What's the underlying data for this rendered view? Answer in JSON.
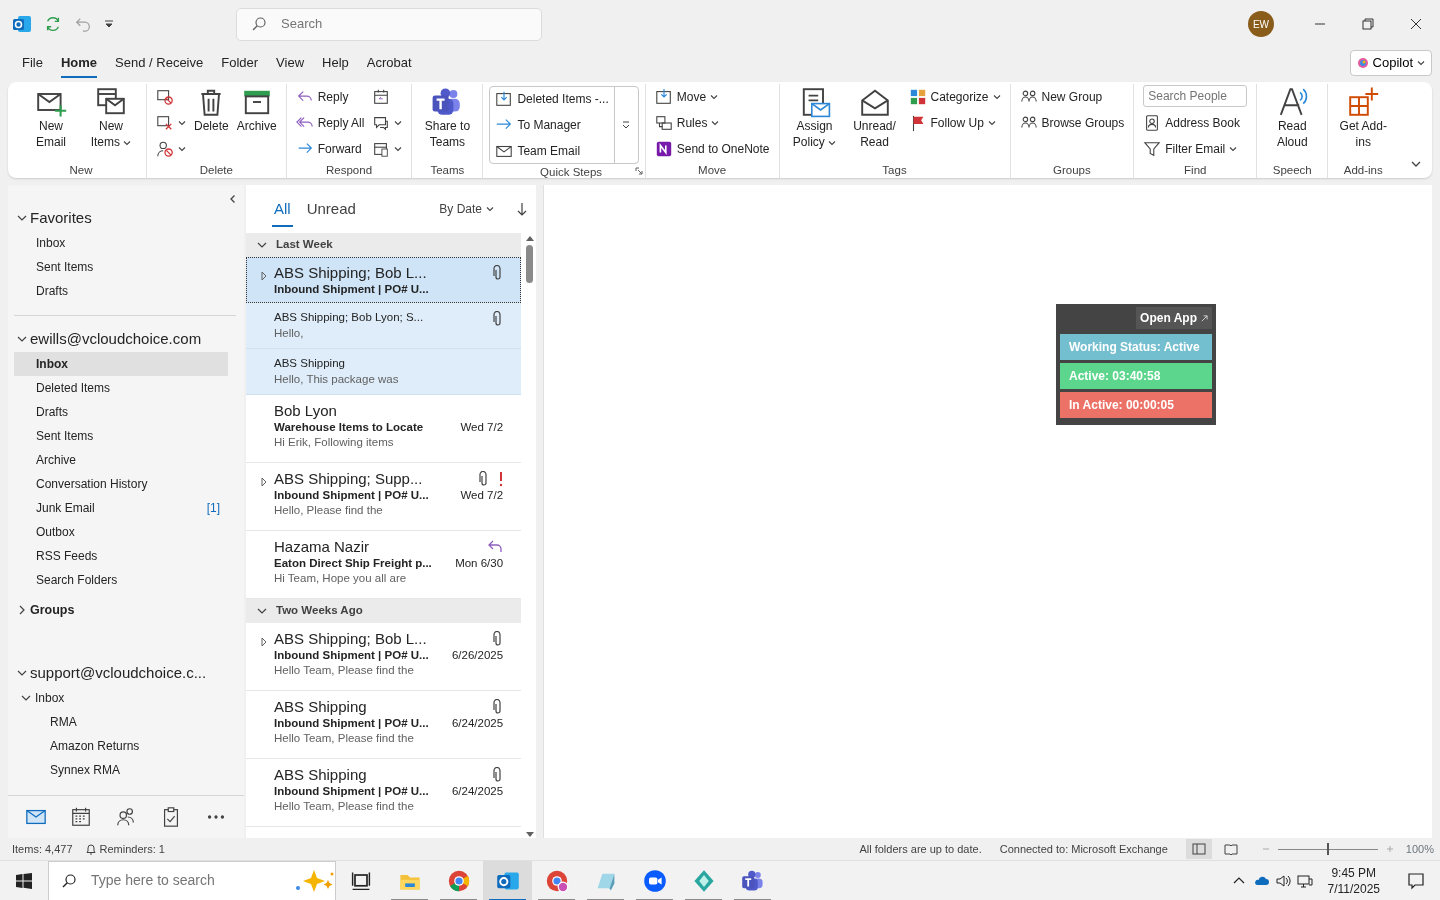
{
  "title_bar": {
    "search": {
      "placeholder": "Search"
    },
    "avatar": "EW"
  },
  "menu_tabs": [
    {
      "label": "File",
      "selected": false
    },
    {
      "label": "Home",
      "selected": true
    },
    {
      "label": "Send / Receive",
      "selected": false
    },
    {
      "label": "Folder",
      "selected": false
    },
    {
      "label": "View",
      "selected": false
    },
    {
      "label": "Help",
      "selected": false
    },
    {
      "label": "Acrobat",
      "selected": false
    }
  ],
  "copilot": {
    "label": "Copilot"
  },
  "ribbon": [
    {
      "label": "New",
      "launcher": false,
      "items": [
        {
          "kind": "large",
          "label": "New Email",
          "dropdown": false
        },
        {
          "kind": "large",
          "label": "New Items",
          "dropdown": true
        }
      ]
    },
    {
      "label": "Delete",
      "launcher": false,
      "items": [
        {
          "kind": "icon",
          "dropdown": false
        },
        {
          "kind": "icon",
          "dropdown": true
        },
        {
          "kind": "icon",
          "dropdown": true
        },
        {
          "kind": "large",
          "label": "Delete",
          "dropdown": false
        },
        {
          "kind": "large",
          "label": "Archive",
          "dropdown": false
        }
      ]
    },
    {
      "label": "Respond",
      "launcher": false,
      "items": [
        {
          "kind": "small",
          "label": "Reply",
          "dropdown": false
        },
        {
          "kind": "small",
          "label": "Reply All",
          "dropdown": false
        },
        {
          "kind": "small",
          "label": "Forward",
          "dropdown": false
        },
        {
          "kind": "icon",
          "dropdown": false
        },
        {
          "kind": "icon",
          "dropdown": true
        },
        {
          "kind": "icon",
          "dropdown": true
        }
      ]
    },
    {
      "label": "Teams",
      "launcher": false,
      "items": [
        {
          "kind": "large",
          "label": "Share to Teams",
          "dropdown": false
        }
      ]
    },
    {
      "label": "Quick Steps",
      "launcher": true,
      "gallery": true,
      "items": [
        {
          "kind": "small",
          "label": "Deleted Items -...",
          "dropdown": false
        },
        {
          "kind": "small",
          "label": "To Manager",
          "dropdown": false
        },
        {
          "kind": "small",
          "label": "Team Email",
          "dropdown": false
        }
      ]
    },
    {
      "label": "Move",
      "launcher": false,
      "items": [
        {
          "kind": "small",
          "label": "Move",
          "dropdown": true
        },
        {
          "kind": "small",
          "label": "Rules",
          "dropdown": true
        },
        {
          "kind": "small",
          "label": "Send to OneNote",
          "dropdown": false
        }
      ]
    },
    {
      "label": "Tags",
      "launcher": false,
      "items": [
        {
          "kind": "large",
          "label": "Assign Policy",
          "dropdown": true
        },
        {
          "kind": "large",
          "label": "Unread/ Read",
          "dropdown": false
        },
        {
          "kind": "small",
          "label": "Categorize",
          "dropdown": true
        },
        {
          "kind": "small",
          "label": "Follow Up",
          "dropdown": true
        }
      ]
    },
    {
      "label": "Groups",
      "launcher": false,
      "items": [
        {
          "kind": "small",
          "label": "New Group",
          "dropdown": false
        },
        {
          "kind": "small",
          "label": "Browse Groups",
          "dropdown": false
        }
      ]
    },
    {
      "label": "Find",
      "launcher": false,
      "items": [
        {
          "kind": "field",
          "placeholder": "Search People"
        },
        {
          "kind": "small",
          "label": "Address Book",
          "dropdown": false
        },
        {
          "kind": "small",
          "label": "Filter Email",
          "dropdown": true
        }
      ]
    },
    {
      "label": "Speech",
      "launcher": false,
      "items": [
        {
          "kind": "large",
          "label": "Read Aloud",
          "dropdown": false
        }
      ]
    },
    {
      "label": "Add-ins",
      "launcher": false,
      "items": [
        {
          "kind": "large",
          "label": "Get Add-ins",
          "dropdown": false
        }
      ]
    }
  ],
  "folder_pane": {
    "sections": [
      {
        "kind": "section",
        "label": "Favorites",
        "expanded": true,
        "folders": [
          {
            "label": "Inbox",
            "selected": false
          },
          {
            "label": "Sent Items",
            "selected": false
          },
          {
            "label": "Drafts",
            "selected": false
          }
        ]
      },
      {
        "kind": "section",
        "label": "ewills@vcloudchoice.com",
        "expanded": true,
        "folders": [
          {
            "label": "Inbox",
            "selected": true
          },
          {
            "label": "Deleted Items",
            "selected": false
          },
          {
            "label": "Drafts",
            "selected": false
          },
          {
            "label": "Sent Items",
            "selected": false
          },
          {
            "label": "Archive",
            "selected": false
          },
          {
            "label": "Conversation History",
            "selected": false
          },
          {
            "label": "Junk Email",
            "count": "[1]",
            "selected": false
          },
          {
            "label": "Outbox",
            "selected": false
          },
          {
            "label": "RSS Feeds",
            "selected": false
          },
          {
            "label": "Search Folders",
            "selected": false
          }
        ]
      },
      {
        "kind": "node",
        "label": "Groups",
        "expanded": false
      },
      {
        "kind": "section",
        "label": "support@vcloudchoice.c...",
        "expanded": true,
        "folders": [
          {
            "label": "Inbox",
            "selected": false,
            "expanded": true,
            "children": [
              {
                "label": "RMA",
                "selected": false
              },
              {
                "label": "Amazon Returns",
                "selected": false
              },
              {
                "label": "Synnex RMA",
                "selected": false
              }
            ]
          }
        ]
      }
    ],
    "nav": [
      {
        "selected": true
      },
      {
        "selected": false
      },
      {
        "selected": false
      },
      {
        "selected": false
      },
      {
        "selected": false
      }
    ]
  },
  "message_list": {
    "filters": [
      {
        "label": "All",
        "selected": true
      },
      {
        "label": "Unread",
        "selected": false
      }
    ],
    "sort": "By Date",
    "items": [
      {
        "kind": "header",
        "label": "Last Week",
        "expanded": true
      },
      {
        "kind": "message",
        "sender": "ABS Shipping;  Bob L...",
        "subject": "Inbound Shipment | PO# U...",
        "selected": true,
        "thread": true,
        "attachment": true,
        "important": false,
        "replied": false
      },
      {
        "kind": "child",
        "sender": "ABS Shipping;  Bob Lyon;  S...",
        "preview": "Hello,",
        "selected": false,
        "attachment": true
      },
      {
        "kind": "child",
        "sender": "ABS Shipping",
        "preview": "Hello,  This package was",
        "selected": false,
        "attachment": false
      },
      {
        "kind": "message",
        "sender": "Bob Lyon",
        "subject": "Warehouse Items to Locate",
        "preview": "Hi Erik,  Following items",
        "date": "Wed 7/2",
        "selected": false,
        "thread": false,
        "attachment": false,
        "important": false,
        "replied": false
      },
      {
        "kind": "message",
        "sender": "ABS Shipping;  Supp...",
        "subject": "Inbound Shipment | PO# U...",
        "preview": "Hello,  Please find the",
        "date": "Wed 7/2",
        "selected": false,
        "thread": true,
        "attachment": true,
        "important": true,
        "replied": false
      },
      {
        "kind": "message",
        "sender": "Hazama Nazir",
        "subject": "Eaton Direct Ship Freight p...",
        "preview": "Hi Team,  Hope you all are",
        "date": "Mon 6/30",
        "selected": false,
        "thread": false,
        "attachment": false,
        "important": false,
        "replied": true
      },
      {
        "kind": "header",
        "label": "Two Weeks Ago",
        "expanded": true
      },
      {
        "kind": "message",
        "sender": "ABS Shipping;  Bob L...",
        "subject": "Inbound Shipment | PO# U...",
        "preview": "Hello Team,  Please find the",
        "date": "6/26/2025",
        "selected": false,
        "thread": true,
        "attachment": true,
        "important": false,
        "replied": false
      },
      {
        "kind": "message",
        "sender": "ABS Shipping",
        "subject": "Inbound Shipment | PO# U...",
        "preview": "Hello Team,  Please find the",
        "date": "6/24/2025",
        "selected": false,
        "thread": false,
        "attachment": true,
        "important": false,
        "replied": false
      },
      {
        "kind": "message",
        "sender": "ABS Shipping",
        "subject": "Inbound Shipment | PO# U...",
        "preview": "Hello Team,  Please find the",
        "date": "6/24/2025",
        "selected": false,
        "thread": false,
        "attachment": true,
        "important": false,
        "replied": false
      }
    ]
  },
  "widget": {
    "link": "Open App",
    "rows": [
      {
        "label": "Working Status: Active",
        "color": "#74bfcf"
      },
      {
        "label": "Active: 03:40:58",
        "color": "#5cd68c"
      },
      {
        "label": "In Active: 00:00:05",
        "color": "#ec7267"
      }
    ]
  },
  "status_bar": {
    "items": "Items: 4,477",
    "reminders": "Reminders: 1",
    "sync": "All folders are up to date.",
    "connection": "Connected to: Microsoft Exchange",
    "views": [
      {
        "selected": true
      },
      {
        "selected": false
      }
    ],
    "zoom": {
      "level": 0.5,
      "label": "100%"
    }
  },
  "taskbar": {
    "search": {
      "placeholder": "Type here to search"
    },
    "apps": [
      {
        "selected": false,
        "running": false
      },
      {
        "selected": false,
        "running": true
      },
      {
        "selected": false,
        "running": true
      },
      {
        "selected": true,
        "running": true
      },
      {
        "selected": false,
        "running": true
      },
      {
        "selected": false,
        "running": true
      },
      {
        "selected": false,
        "running": true
      },
      {
        "selected": false,
        "running": true
      },
      {
        "selected": false,
        "running": true
      }
    ],
    "time": "9:45 PM",
    "date": "7/11/2025"
  }
}
